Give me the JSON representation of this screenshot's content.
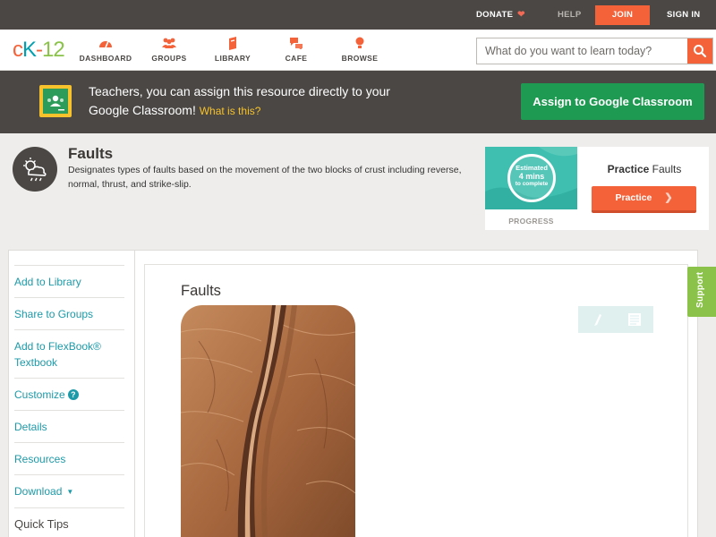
{
  "topbar": {
    "donate": "DONATE",
    "help": "HELP",
    "join": "JOIN",
    "signin": "SIGN IN"
  },
  "nav": {
    "logo": {
      "c": "c",
      "k": "K",
      "dash": "-",
      "n": "12"
    },
    "items": [
      {
        "label": "DASHBOARD",
        "icon": "dashboard-icon"
      },
      {
        "label": "GROUPS",
        "icon": "groups-icon"
      },
      {
        "label": "LIBRARY",
        "icon": "library-icon"
      },
      {
        "label": "CAFE",
        "icon": "cafe-icon"
      },
      {
        "label": "BROWSE",
        "icon": "browse-icon"
      }
    ],
    "search_placeholder": "What do you want to learn today?"
  },
  "classroom_banner": {
    "text": "Teachers, you can assign this resource directly to your Google Classroom!",
    "link": "What is this?",
    "button": "Assign to Google Classroom"
  },
  "concept": {
    "icon": "weather-icon",
    "title": "Faults",
    "description": "Designates types of faults based on the movement of the two blocks of crust including reverse, normal, thrust, and strike-slip."
  },
  "practice": {
    "estimate_line1": "Estimated",
    "estimate_line2": "4 mins",
    "estimate_line3": "to complete",
    "progress_label": "PROGRESS",
    "title_bold": "Practice",
    "title_rest": "Faults",
    "button": "Practice"
  },
  "sidebar": {
    "items": [
      {
        "label": "Add to Library"
      },
      {
        "label": "Share to Groups"
      },
      {
        "label": "Add to FlexBook® Textbook"
      },
      {
        "label": "Customize"
      },
      {
        "label": "Details"
      },
      {
        "label": "Resources"
      },
      {
        "label": "Download"
      },
      {
        "label": "Quick Tips"
      }
    ]
  },
  "reader": {
    "title": "Faults"
  },
  "support": "Support",
  "colors": {
    "accent": "#f4623a",
    "teal": "#1d9aa8",
    "green": "#1f9a52",
    "dark": "#4a4744"
  }
}
